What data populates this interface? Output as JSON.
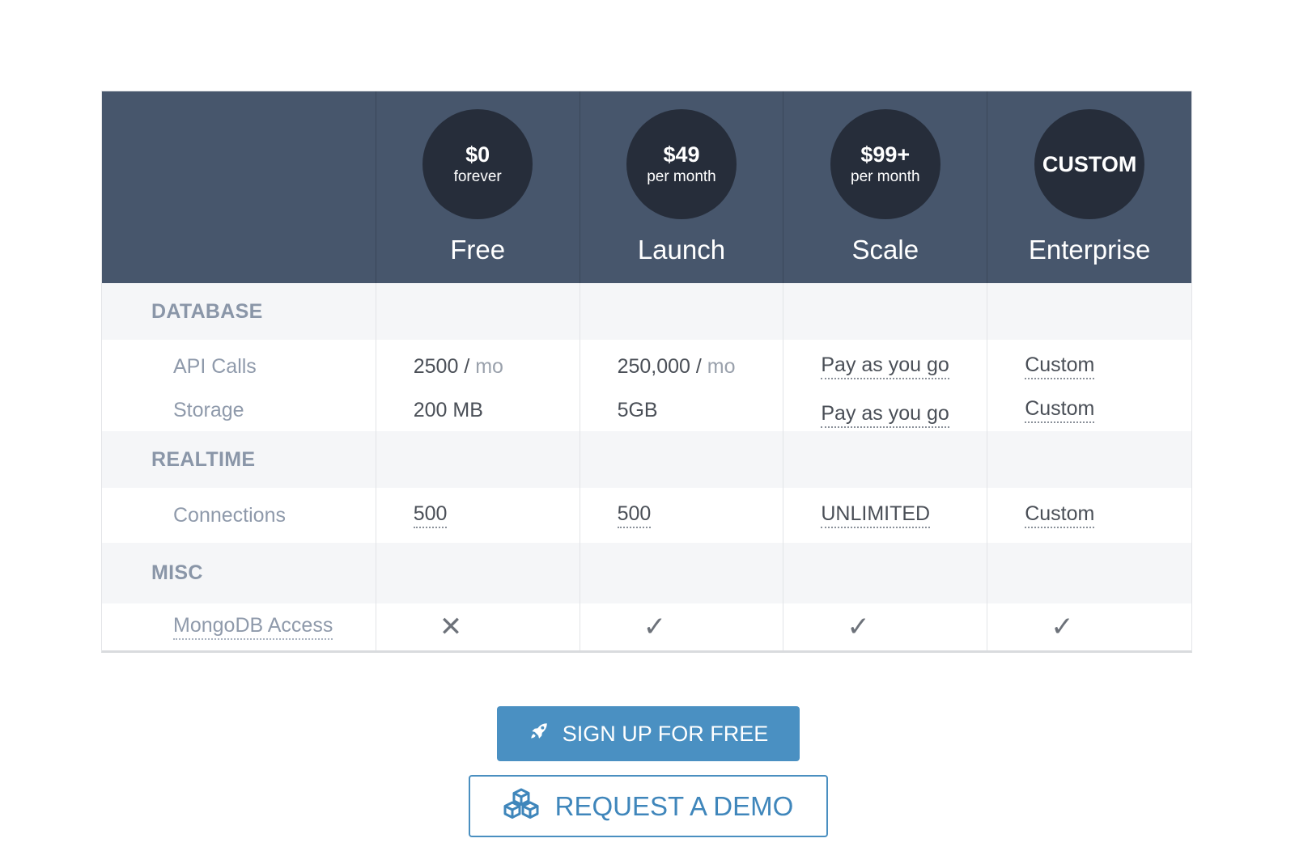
{
  "plans": [
    {
      "price": "$0",
      "period": "forever",
      "name": "Free"
    },
    {
      "price": "$49",
      "period": "per month",
      "name": "Launch"
    },
    {
      "price": "$99+",
      "period": "per month",
      "name": "Scale"
    },
    {
      "price": "CUSTOM",
      "period": "",
      "name": "Enterprise"
    }
  ],
  "sections": {
    "database": {
      "title": "DATABASE",
      "api_calls": {
        "label": "API Calls",
        "values": [
          "2500",
          "250,000",
          "Pay as you go",
          "Custom"
        ],
        "unit_sep": "/",
        "unit": "mo"
      },
      "storage": {
        "label": "Storage",
        "values": [
          "200 MB",
          "5GB",
          "Pay as you go",
          "Custom"
        ]
      }
    },
    "realtime": {
      "title": "REALTIME",
      "connections": {
        "label": "Connections",
        "values": [
          "500",
          "500",
          "UNLIMITED",
          "Custom"
        ]
      }
    },
    "misc": {
      "title": "MISC",
      "mongodb": {
        "label": "MongoDB Access",
        "values": [
          "✕",
          "✓",
          "✓",
          "✓"
        ]
      }
    }
  },
  "buttons": {
    "signup": "SIGN UP FOR FREE",
    "demo": "REQUEST A DEMO"
  },
  "colors": {
    "header_bg": "#47566c",
    "circle_bg": "#262d3a",
    "primary": "#4a90c2"
  },
  "icons": {
    "signup": "rocket-icon",
    "demo": "cubes-icon"
  }
}
